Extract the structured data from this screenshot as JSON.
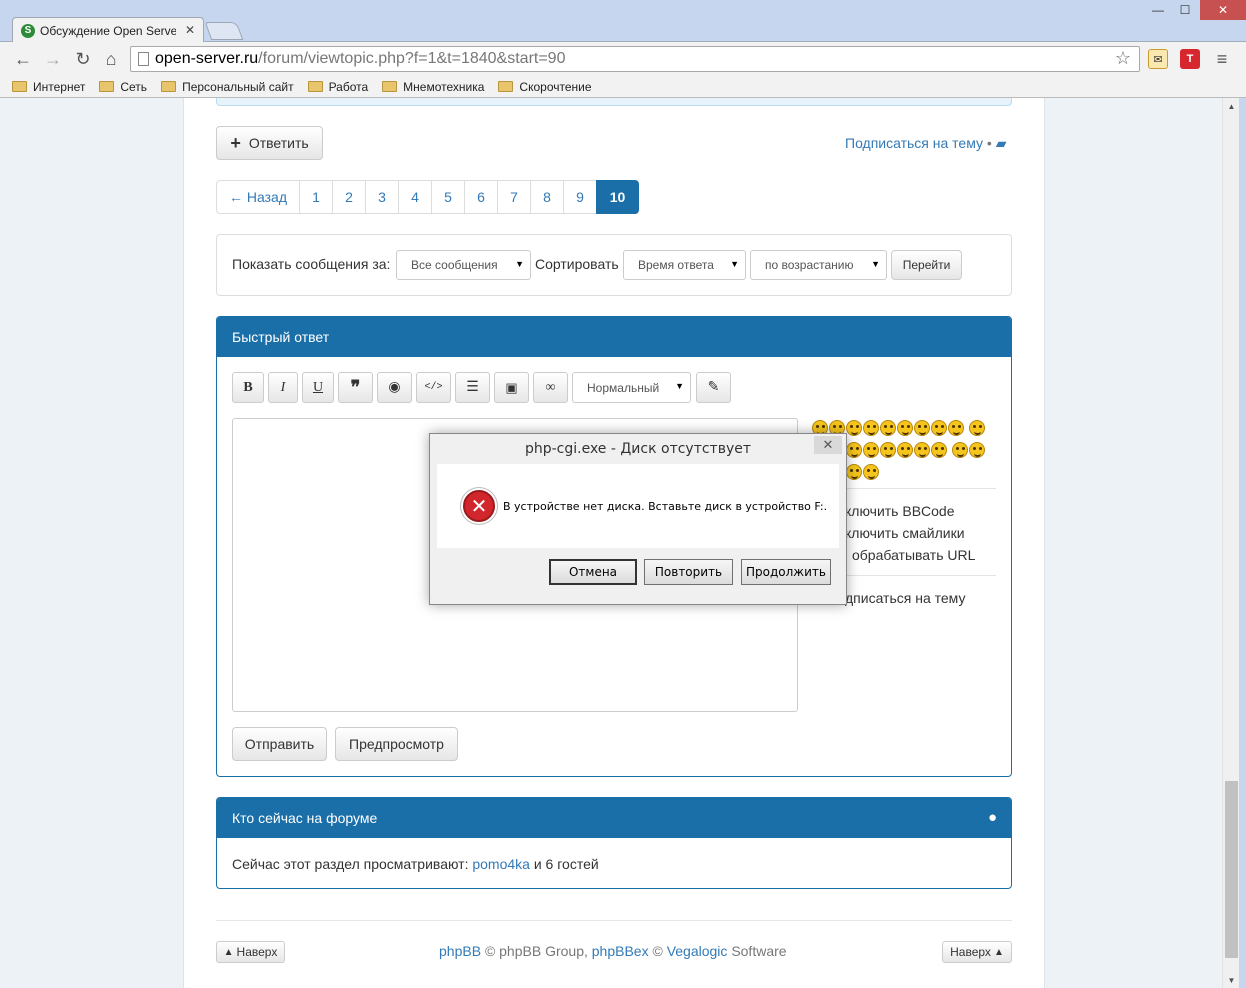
{
  "browser": {
    "tab_title": "Обсуждение Open Server",
    "tab_favicon": "S",
    "url_host": "open-server.ru",
    "url_path": "/forum/viewtopic.php?f=1&t=1840&start=90",
    "extensions": [
      "adblock-icon",
      "td3-icon"
    ]
  },
  "bookmarks": [
    "Интернет",
    "Сеть",
    "Персональный сайт",
    "Работа",
    "Мнемотехника",
    "Скорочтение"
  ],
  "forum": {
    "reply_button": "Ответить",
    "subscribe_link": "Подписаться на тему",
    "subscribe_sep": "•",
    "pagination": {
      "prev": "← Назад",
      "pages": [
        "1",
        "2",
        "3",
        "4",
        "5",
        "6",
        "7",
        "8",
        "9"
      ],
      "current": "10"
    },
    "filter": {
      "show_label": "Показать сообщения за:",
      "show_value": "Все сообщения",
      "sort_label": "Сортировать",
      "sort_value": "Время ответа",
      "order_value": "по возрастанию",
      "go_button": "Перейти"
    },
    "quick_reply": {
      "title": "Быстрый ответ",
      "toolbar": {
        "bold": "B",
        "italic": "I",
        "underline": "U",
        "font_size": "Нормальный"
      },
      "options": [
        "ключить BBCode",
        "ключить смайлики",
        "обрабатывать URL"
      ],
      "subscribe": "дписаться на тему",
      "submit": "Отправить",
      "preview": "Предпросмотр"
    },
    "who_online": {
      "title": "Кто сейчас на форуме",
      "text_before": "Сейчас этот раздел просматривают:",
      "user": "pomo4ka",
      "text_after": "и 6 гостей"
    },
    "footer": {
      "top_left": "Наверх",
      "top_right": "Наверх",
      "phpbb": "phpBB",
      "group": "© phpBB Group,",
      "phpbbex": "phpBBex",
      "copy": "©",
      "vega": "Vegalogic",
      "software": "Software"
    }
  },
  "dialog": {
    "title": "php-cgi.exe - Диск отсутствует",
    "message": "В устройстве нет диска. Вставьте диск в устройство F:.",
    "cancel": "Отмена",
    "retry": "Повторить",
    "continue": "Продолжить"
  },
  "colors": {
    "primary": "#1a6fa8",
    "link": "#337ab7",
    "error": "#d1272c"
  }
}
